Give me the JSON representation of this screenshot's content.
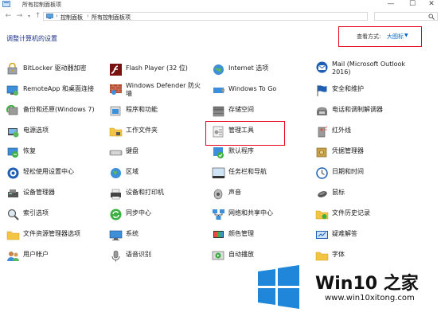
{
  "window": {
    "title": "所有控制面板项",
    "colors": {
      "accent": "#1e3287",
      "link": "#0066cc",
      "highlight": "#e8001f"
    }
  },
  "address": {
    "crumbs": [
      "控制面板",
      "所有控制面板项"
    ],
    "search_icon": "search-icon"
  },
  "header": {
    "heading": "调整计算机的设置",
    "view_by_label": "查看方式:",
    "view_by_value": "大图标"
  },
  "items": {
    "c1": [
      {
        "label": "BitLocker 驱动器加密",
        "icon": "bitlocker-icon"
      },
      {
        "label": "RemoteApp 和桌面连接",
        "icon": "remoteapp-icon"
      },
      {
        "label": "备份和还原(Windows 7)",
        "icon": "backup-icon"
      },
      {
        "label": "电源选项",
        "icon": "power-icon"
      },
      {
        "label": "恢复",
        "icon": "recovery-icon"
      },
      {
        "label": "轻松使用设置中心",
        "icon": "ease-of-access-icon"
      },
      {
        "label": "设备管理器",
        "icon": "device-manager-icon"
      },
      {
        "label": "索引选项",
        "icon": "indexing-icon"
      },
      {
        "label": "文件资源管理器选项",
        "icon": "folder-options-icon"
      },
      {
        "label": "用户帐户",
        "icon": "user-accounts-icon"
      }
    ],
    "c2": [
      {
        "label": "Flash Player (32 位)",
        "icon": "flash-icon"
      },
      {
        "label": "Windows Defender 防火墙",
        "icon": "firewall-icon"
      },
      {
        "label": "程序和功能",
        "icon": "programs-icon"
      },
      {
        "label": "工作文件夹",
        "icon": "work-folders-icon"
      },
      {
        "label": "键盘",
        "icon": "keyboard-icon"
      },
      {
        "label": "区域",
        "icon": "region-icon"
      },
      {
        "label": "设备和打印机",
        "icon": "printer-icon"
      },
      {
        "label": "同步中心",
        "icon": "sync-icon"
      },
      {
        "label": "系统",
        "icon": "system-icon"
      },
      {
        "label": "语音识别",
        "icon": "microphone-icon"
      }
    ],
    "c3": [
      {
        "label": "Internet 选项",
        "icon": "internet-icon"
      },
      {
        "label": "Windows To Go",
        "icon": "windows-to-go-icon"
      },
      {
        "label": "存储空间",
        "icon": "storage-icon"
      },
      {
        "label": "管理工具",
        "icon": "admin-tools-icon"
      },
      {
        "label": "默认程序",
        "icon": "default-programs-icon"
      },
      {
        "label": "任务栏和导航",
        "icon": "taskbar-icon"
      },
      {
        "label": "声音",
        "icon": "sound-icon"
      },
      {
        "label": "网络和共享中心",
        "icon": "network-icon"
      },
      {
        "label": "颜色管理",
        "icon": "color-icon"
      },
      {
        "label": "自动播放",
        "icon": "autoplay-icon"
      }
    ],
    "c4": [
      {
        "label": "Mail (Microsoft Outlook 2016)",
        "icon": "mail-icon"
      },
      {
        "label": "安全和维护",
        "icon": "security-flag-icon"
      },
      {
        "label": "电话和调制解调器",
        "icon": "phone-icon"
      },
      {
        "label": "红外线",
        "icon": "infrared-icon"
      },
      {
        "label": "凭据管理器",
        "icon": "credential-icon"
      },
      {
        "label": "日期和时间",
        "icon": "clock-icon"
      },
      {
        "label": "鼠标",
        "icon": "mouse-icon"
      },
      {
        "label": "文件历史记录",
        "icon": "file-history-icon"
      },
      {
        "label": "疑难解答",
        "icon": "troubleshoot-icon"
      },
      {
        "label": "字体",
        "icon": "fonts-icon"
      }
    ]
  },
  "watermark": {
    "brand": "Win10 之家",
    "url": "www.win10xitong.com"
  }
}
